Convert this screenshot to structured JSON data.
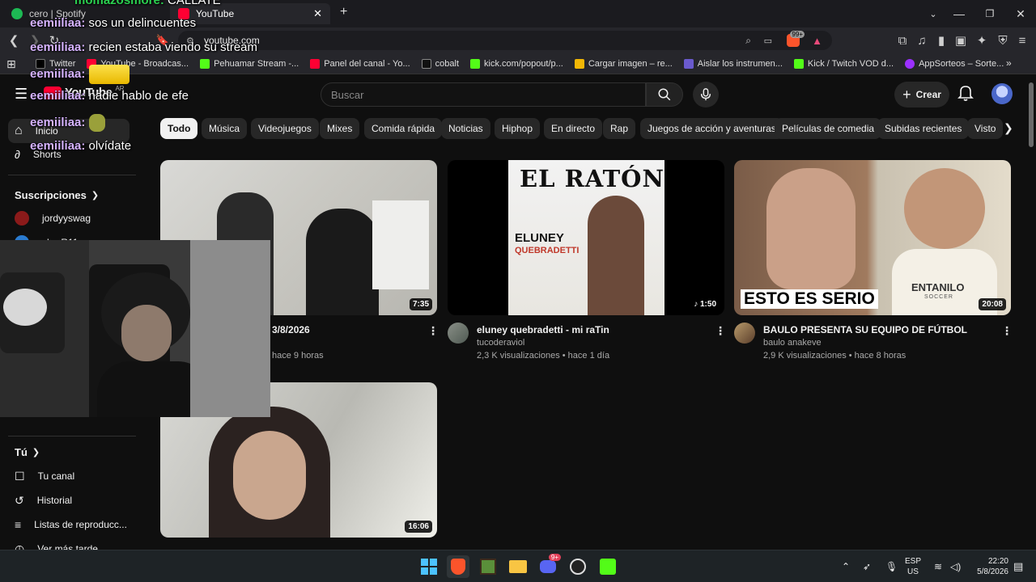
{
  "browser": {
    "tabs": [
      {
        "label": "cero | Spotify"
      },
      {
        "label": "YouTube"
      }
    ],
    "url": "youtube.com",
    "bookmarks": [
      {
        "label": "Twitter"
      },
      {
        "label": "YouTube - Broadcas..."
      },
      {
        "label": "Pehuamar Stream -..."
      },
      {
        "label": "Panel del canal - Yo..."
      },
      {
        "label": "cobalt"
      },
      {
        "label": "kick.com/popout/p..."
      },
      {
        "label": "Cargar imagen – re..."
      },
      {
        "label": "Aislar los instrumen..."
      },
      {
        "label": "Kick / Twitch VOD d..."
      },
      {
        "label": "AppSorteos – Sorte..."
      }
    ],
    "extension_badge": "99+"
  },
  "youtube": {
    "logo": "YouTube",
    "logo_region": "AR",
    "search_placeholder": "Buscar",
    "create_label": "Crear",
    "chips": [
      "Todo",
      "Música",
      "Videojuegos",
      "Mixes",
      "Comida rápida",
      "Noticias",
      "Hiphop",
      "En directo",
      "Rap",
      "Juegos de acción y aventuras",
      "Películas de comedia",
      "Subidas recientes",
      "Visto"
    ],
    "sidebar": {
      "home": "Inicio",
      "shorts": "Shorts",
      "subscriptions": "Suscripciones",
      "subs": [
        {
          "name": "jordyyswag"
        },
        {
          "name": "chr_R11"
        }
      ],
      "you": "Tú",
      "you_items": [
        "Tu canal",
        "Historial",
        "Listas de reproducc...",
        "Ver más tarde"
      ]
    },
    "videos": [
      {
        "title": "3/8/2026",
        "channel": "",
        "meta": "hace 9 horas",
        "duration": "7:35"
      },
      {
        "title": "eluney quebradetti - mi raTin",
        "channel": "tucoderaviol",
        "meta": "2,3 K visualizaciones • hace 1 día",
        "duration": "1:50",
        "thumb_title": "EL RATÓN",
        "thumb_artist": "ELUNEY",
        "thumb_artist2": "QUEBRADETTI"
      },
      {
        "title": "BAULO PRESENTA SU EQUIPO DE FÚTBOL",
        "channel": "baulo anakeve",
        "meta": "2,9 K visualizaciones • hace 8 horas",
        "duration": "20:08",
        "thumb_caption": "ESTO ES SERIO",
        "thumb_shirt": "ENTANILO",
        "thumb_shirt2": "SOCCER"
      },
      {
        "title": "",
        "channel": "",
        "meta": "",
        "duration": "16:06"
      }
    ]
  },
  "chat": [
    {
      "user": "momazosmore:",
      "msg": "CALLATE"
    },
    {
      "user": "eemiiliaa:",
      "msg": "sos un delincuentes"
    },
    {
      "user": "eemiiliaa:",
      "msg": "recien estaba viendo su stream"
    },
    {
      "user": "eemiiliaa:",
      "msg": ""
    },
    {
      "user": "eemiiliaa:",
      "msg": "nadie hablo de efe"
    },
    {
      "user": "eemiiliaa:",
      "msg": ""
    },
    {
      "user": "eemiiliaa:",
      "msg": "olvídate"
    }
  ],
  "taskbar": {
    "lang": "ESP",
    "region": "US",
    "time": "22:20",
    "date": "5/8/2026",
    "discord_badge": "9+"
  },
  "colors": {
    "accent_red": "#ff0033",
    "chip_selected": "#f1f1f1",
    "chat_user": "#d6b3ff"
  }
}
